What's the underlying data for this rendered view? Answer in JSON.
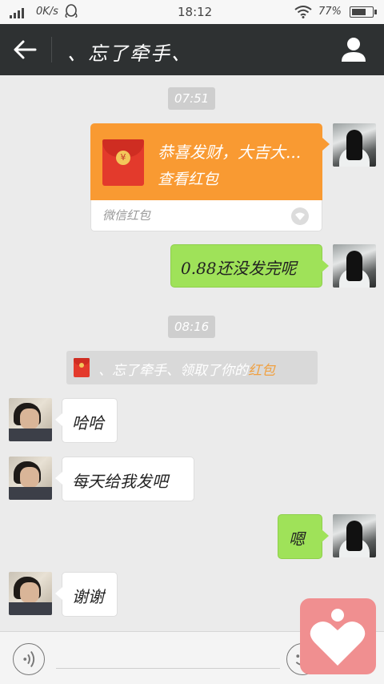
{
  "status_bar": {
    "speed": "0K/s",
    "time": "18:12",
    "battery_percent": "77%",
    "battery_level": 0.77
  },
  "header": {
    "title": "、忘了牵手、",
    "back_icon": "arrow-left-icon",
    "profile_icon": "person-icon"
  },
  "messages": {
    "time1": "07:51",
    "red_packet": {
      "greeting": "恭喜发财，大吉大...",
      "view": "查看红包",
      "brand": "微信红包"
    },
    "msg_self_1": "0.88还没发完呢",
    "time2": "08:16",
    "system_note": {
      "prefix": "、忘了牵手、领取了你的",
      "highlight": "红包"
    },
    "msg_other_1": "哈哈",
    "msg_other_2": "每天给我发吧",
    "msg_self_2": "嗯",
    "msg_other_3": "谢谢"
  },
  "input_bar": {
    "voice_icon": "voice-icon",
    "emoji_icon": "emoji-icon"
  },
  "floating_button": {
    "icon": "heart-person-icon"
  },
  "colors": {
    "header_bg": "#2e3132",
    "green_bubble": "#9fe259",
    "red_packet": "#f99a32",
    "float_button": "#f08f90"
  }
}
